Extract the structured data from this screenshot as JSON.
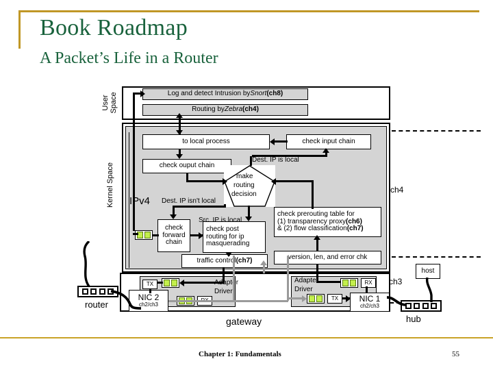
{
  "slide": {
    "title": "Book Roadmap",
    "subtitle": "A Packet’s Life in a Router",
    "accent_color": "#c09726",
    "title_color": "#19623c"
  },
  "footer": {
    "chapter": "Chapter 1: Fundamentals",
    "page_number": "55"
  },
  "zones": {
    "user_space": "User\nSpace",
    "user_space_line1": "User",
    "user_space_line2": "Space",
    "kernel_space": "Kernel Space",
    "ipv4": "IPv4",
    "gateway": "gateway",
    "router": "router",
    "hub": "hub",
    "host": "host",
    "ch4": "ch4",
    "ch3": "ch3"
  },
  "user_space_boxes": [
    {
      "id": "snort",
      "text": "Log and detect Intrusion by Snort (ch8)",
      "pre": "Log and detect Intrusion by ",
      "italic": "Snort",
      "bold": "(ch8)"
    },
    {
      "id": "zebra",
      "text": "Routing by Zebra (ch4)",
      "pre": "Routing by ",
      "italic": "Zebra",
      "bold": "(ch4)"
    }
  ],
  "kernel_boxes": {
    "to_local_process": "to local process",
    "check_input_chain": "check input chain",
    "check_ouput_chain": "check ouput chain",
    "make_routing_decision_l1": "make",
    "make_routing_decision_l2": "routing",
    "make_routing_decision_l3": "decision",
    "check_forward_chain_l1": "check",
    "check_forward_chain_l2": "forward",
    "check_forward_chain_l3": "chain",
    "check_post_routing_l1": "check post",
    "check_post_routing_l2": "routing for ip",
    "check_post_routing_l3": "masquerading",
    "check_prerouting_l1": "check prerouting table for",
    "check_prerouting_l2a": "(1) transparency proxy",
    "check_prerouting_l2b": "(ch6)",
    "check_prerouting_l3a": "& (2) flow classification",
    "check_prerouting_l3b": "(ch7)",
    "traffic_control_a": "traffic control ",
    "traffic_control_b": "(ch7)",
    "version_len_error": "version, len, and error chk"
  },
  "edge_labels": {
    "dest_ip_is_local": "Dest. IP is local",
    "dest_ip_isnt_local": "Dest. IP isn't local",
    "src_ip_is_local": "Src. IP is local"
  },
  "hardware": {
    "adapter_driver_l1": "Adapter",
    "adapter_driver_l2": "Driver",
    "nic2_name": "NIC 2",
    "nic2_sub": "ch2/ch3",
    "nic1_name": "NIC 1",
    "nic1_sub": "ch2/ch3",
    "tx": "TX",
    "rx": "RX"
  },
  "colors": {
    "box_fill_grey": "#d4d4d4",
    "led_green": "#c3ef4c",
    "connector_grey": "#9a9a9a"
  }
}
